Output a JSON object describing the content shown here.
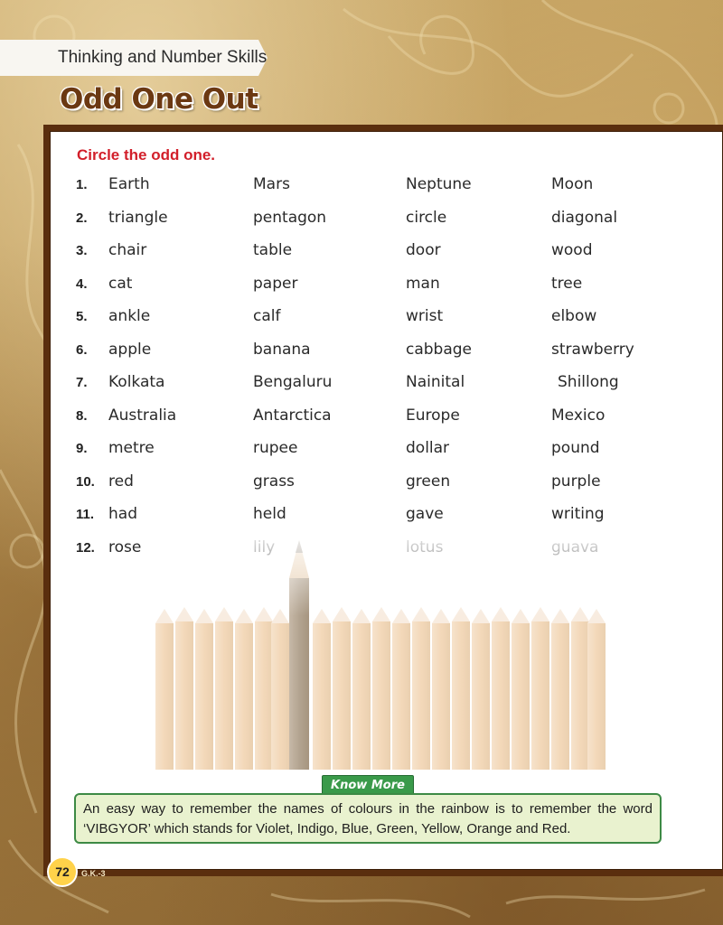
{
  "header": {
    "section_label": "Thinking and Number Skills",
    "page_title": "Odd One Out"
  },
  "exercise": {
    "instruction": "Circle the odd one.",
    "rows": [
      {
        "num": "1.",
        "words": [
          "Earth",
          "Mars",
          "Neptune",
          "Moon"
        ]
      },
      {
        "num": "2.",
        "words": [
          "triangle",
          "pentagon",
          "circle",
          "diagonal"
        ]
      },
      {
        "num": "3.",
        "words": [
          "chair",
          "table",
          "door",
          "wood"
        ]
      },
      {
        "num": "4.",
        "words": [
          "cat",
          "paper",
          "man",
          "tree"
        ]
      },
      {
        "num": "5.",
        "words": [
          "ankle",
          "calf",
          "wrist",
          "elbow"
        ]
      },
      {
        "num": "6.",
        "words": [
          "apple",
          "banana",
          "cabbage",
          "strawberry"
        ]
      },
      {
        "num": "7.",
        "words": [
          "Kolkata",
          "Bengaluru",
          "Nainital",
          "Shillong"
        ]
      },
      {
        "num": "8.",
        "words": [
          "Australia",
          "Antarctica",
          "Europe",
          "Mexico"
        ]
      },
      {
        "num": "9.",
        "words": [
          "metre",
          "rupee",
          "dollar",
          "pound"
        ]
      },
      {
        "num": "10.",
        "words": [
          "red",
          "grass",
          "green",
          "purple"
        ]
      },
      {
        "num": "11.",
        "words": [
          "had",
          "held",
          "gave",
          "writing"
        ]
      },
      {
        "num": "12.",
        "words": [
          "rose",
          "lily",
          "lotus",
          "guava"
        ]
      }
    ]
  },
  "know_more": {
    "label": "Know More",
    "text": "An easy way to remember the names of colours in the rainbow is to remember the word ‘VIBGYOR’ which stands for Violet, Indigo, Blue, Green, Yellow, Orange and Red."
  },
  "footer": {
    "page_number": "72",
    "book_code": "G.K.-3"
  },
  "colors": {
    "title_brown": "#6b3812",
    "frame_brown": "#5a2e0e",
    "instruction_red": "#d21f2a",
    "know_more_green": "#3a9a4a",
    "pencil_light": "#f3dcc0",
    "pencil_highlight": "#b9aa98"
  }
}
